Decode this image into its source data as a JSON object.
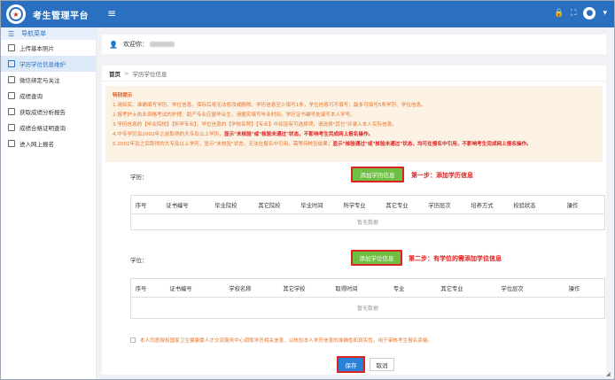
{
  "header": {
    "title": "考生管理平台",
    "logo_glyph": "★",
    "menu_icon": "hamburger-icon",
    "right_icons": [
      "lock-icon",
      "fullscreen-icon",
      "user-avatar-icon"
    ],
    "brand_color": "#2b6fc0"
  },
  "sidebar": {
    "heading": "导航菜单",
    "items": [
      {
        "label": "上传基本照片",
        "icon": "image-icon",
        "active": false
      },
      {
        "label": "学历学位信息维护",
        "icon": "document-icon",
        "active": true
      },
      {
        "label": "微信绑定与关注",
        "icon": "wechat-icon",
        "active": false
      },
      {
        "label": "成绩查询",
        "icon": "file-icon",
        "active": false
      },
      {
        "label": "获取成绩分析报告",
        "icon": "report-icon",
        "active": false
      },
      {
        "label": "成绩合格证明查询",
        "icon": "certificate-icon",
        "active": false
      },
      {
        "label": "进入网上报名",
        "icon": "enter-icon",
        "active": false
      }
    ]
  },
  "welcome": {
    "prefix": "欢迎你："
  },
  "breadcrumb": {
    "home": "首页",
    "separator": ">",
    "current": "学历学位信息"
  },
  "notice": {
    "title": "特别提示",
    "lines": [
      {
        "text": "1.请如实、准确填写学历、学位信息，保存后将无法修改或删除。学历信息至少填写1条，学位信息可不填写；最多可填写5条学历、学位信息。"
      },
      {
        "text": "2.报考护士执业资格考试的护理、助产专业应届毕业生，请据实填写毕业时间，学历证书编号处填写本人学号。"
      },
      {
        "text": "3.学历信息的【毕业院校】【所学专业】，学位信息的【学校名称】【专业】中如没有可选择项，请选择\"其它\"并录入本人实际信息。"
      },
      {
        "text": "4.中专学历及2002年之前取得的大专及以上学历，",
        "red": "显示\"未核验\"或\"核验未通过\"状态，不影响考生完成网上报名操作。"
      },
      {
        "text": "5.2002年及之后取得的大专及以上学历，显示\"未核验\"状态，无法在报名中引用，需等待核验结果；",
        "red": "显示\"核验通过\"或\"核验未通过\"状态，均可在报名中引用，不影响考生完成网上报名操作。"
      }
    ]
  },
  "education": {
    "label": "学历：",
    "add_button": "添加学历信息",
    "step_text": "第一步：添加学历信息",
    "columns": [
      "序号",
      "证书编号",
      "毕业院校",
      "其它院校",
      "毕业时间",
      "所学专业",
      "其它专业",
      "学历层次",
      "培养方式",
      "校验状态",
      "操作"
    ],
    "empty_text": "暂无数据"
  },
  "degree": {
    "label": "学位：",
    "add_button": "添加学位信息",
    "step_text": "第二步：有学位的需添加学位信息",
    "columns": [
      "序号",
      "证书编号",
      "学校名称",
      "其它学校",
      "取得时间",
      "专业",
      "其它专业",
      "学位层次",
      "操作"
    ],
    "empty_text": "暂无数据"
  },
  "consent": {
    "text": "本人同意授权国家卫生健康委人才交流服务中心调取学历相关信息，以核验本人学历信息的准确性和真实性，用于审核考生报名资格。",
    "checked": false
  },
  "actions": {
    "save": "保存",
    "cancel": "取消"
  },
  "colors": {
    "green_button": "#6fbf45",
    "save_button": "#2b80d8",
    "highlight_border": "#dd2222",
    "notice_bg": "#fcf2e3",
    "notice_text": "#e8742c"
  }
}
